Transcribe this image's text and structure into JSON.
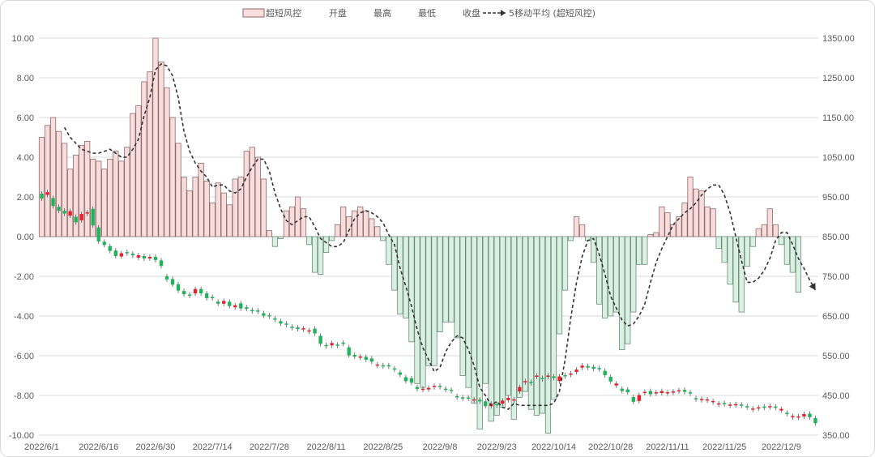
{
  "chart_data": {
    "type": "bar+candlestick+line",
    "legend": {
      "placement": "top-center",
      "items": [
        {
          "label": "超短风控",
          "kind": "bar"
        },
        {
          "label": "开盘",
          "kind": "none"
        },
        {
          "label": "最高",
          "kind": "none"
        },
        {
          "label": "最低",
          "kind": "none"
        },
        {
          "label": "收盘",
          "kind": "none"
        },
        {
          "label": "5移动平均 (超短风控)",
          "kind": "dashed-line"
        }
      ]
    },
    "colors": {
      "bar_pos_fill": "#f9dcdc",
      "bar_pos_stroke": "#8c6a6a",
      "bar_neg_fill": "#daf0e3",
      "bar_neg_stroke": "#6b8c78",
      "candle_up": "#e8202a",
      "candle_down": "#1fb35a",
      "ma_line": "#333333",
      "grid": "#d9d9d9"
    },
    "y_left": {
      "min": -10,
      "max": 10,
      "step": 2,
      "tick_labels": [
        "10.00",
        "8.00",
        "6.00",
        "4.00",
        "2.00",
        "0.00",
        "-2.00",
        "-4.00",
        "-6.00",
        "-8.00",
        "-10.00"
      ]
    },
    "y_right": {
      "min": 350,
      "max": 1350,
      "step": 100,
      "tick_labels": [
        "1350.00",
        "1250.00",
        "1150.00",
        "1050.00",
        "950.00",
        "850.00",
        "750.00",
        "650.00",
        "550.00",
        "450.00",
        "350.00"
      ]
    },
    "x_tick_labels": [
      "2022/6/1",
      "2022/6/16",
      "2022/6/30",
      "2022/7/14",
      "2022/7/28",
      "2022/8/11",
      "2022/8/25",
      "2022/9/8",
      "2022/9/23",
      "2022/10/14",
      "2022/10/28",
      "2022/11/11",
      "2022/11/25",
      "2022/12/9"
    ],
    "x_tick_indices": [
      0,
      10,
      20,
      30,
      40,
      50,
      60,
      70,
      80,
      90,
      100,
      110,
      120,
      130
    ],
    "n_slots": 137,
    "bars": [
      5.0,
      5.6,
      6.0,
      5.3,
      4.7,
      3.4,
      4.1,
      4.6,
      4.8,
      3.9,
      3.8,
      3.4,
      3.9,
      4.3,
      3.8,
      4.5,
      6.2,
      6.6,
      7.8,
      8.3,
      10.0,
      8.8,
      7.5,
      6.0,
      4.7,
      3.0,
      2.3,
      3.0,
      3.7,
      2.8,
      1.7,
      2.7,
      2.2,
      1.6,
      2.9,
      3.0,
      4.3,
      4.5,
      4.0,
      2.9,
      0.3,
      -0.5,
      -0.1,
      1.3,
      1.5,
      2.0,
      1.4,
      -0.4,
      -1.8,
      -1.9,
      -0.8,
      -0.2,
      0.6,
      1.5,
      1.0,
      1.3,
      1.5,
      1.3,
      0.9,
      0.5,
      -0.2,
      -1.4,
      -2.7,
      -3.9,
      -4.1,
      -5.3,
      -7.4,
      -7.6,
      -6.5,
      -6.5,
      -4.8,
      -4.3,
      -4.3,
      -5.1,
      -7.0,
      -7.6,
      -8.4,
      -9.7,
      -7.4,
      -9.3,
      -9.0,
      -8.6,
      -8.0,
      -9.2,
      -8.1,
      -7.8,
      -8.7,
      -9.0,
      -8.9,
      -9.9,
      -8.2,
      -4.9,
      -2.7,
      -0.2,
      1.0,
      0.6,
      -0.2,
      -1.3,
      -3.4,
      -4.1,
      -4.0,
      -3.8,
      -5.7,
      -5.4,
      -3.8,
      -1.4,
      -1.4,
      0.1,
      0.2,
      1.5,
      1.2,
      0.6,
      1.0,
      1.7,
      3.0,
      2.4,
      2.3,
      1.5,
      1.4,
      -0.6,
      -1.3,
      -2.4,
      -3.3,
      -3.8,
      -1.5,
      -0.5,
      0.4,
      0.6,
      1.4,
      0.6,
      -0.4,
      -1.4,
      -1.8,
      -2.8,
      0.0,
      0.0,
      0.0
    ],
    "ma5": [
      null,
      null,
      null,
      null,
      5.5,
      5.0,
      4.7,
      4.4,
      4.3,
      4.2,
      4.2,
      4.3,
      4.4,
      4.2,
      4.0,
      4.0,
      4.4,
      4.9,
      6.1,
      7.0,
      8.4,
      8.7,
      8.6,
      8.1,
      7.0,
      5.3,
      4.3,
      3.7,
      3.3,
      3.0,
      2.5,
      2.6,
      2.6,
      2.3,
      2.2,
      2.4,
      3.0,
      3.5,
      3.9,
      3.9,
      3.3,
      2.2,
      1.4,
      0.8,
      0.6,
      0.8,
      1.0,
      1.0,
      0.5,
      -0.1,
      -0.3,
      -0.5,
      -0.5,
      -0.3,
      0.3,
      0.9,
      1.2,
      1.3,
      1.2,
      1.0,
      0.7,
      0.1,
      -0.4,
      -1.6,
      -2.5,
      -3.5,
      -4.7,
      -5.6,
      -6.2,
      -6.8,
      -6.6,
      -5.8,
      -5.3,
      -5.0,
      -5.1,
      -5.7,
      -6.5,
      -7.6,
      -8.0,
      -8.5,
      -8.3,
      -8.6,
      -8.7,
      -8.4,
      -8.5,
      -8.5,
      -8.5,
      -8.5,
      -8.5,
      -8.5,
      -8.4,
      -7.8,
      -6.2,
      -4.1,
      -2.3,
      -1.0,
      -0.2,
      -0.1,
      -0.9,
      -1.9,
      -3.0,
      -3.6,
      -4.2,
      -4.5,
      -4.4,
      -4.0,
      -3.4,
      -2.3,
      -1.3,
      -0.6,
      0.0,
      0.6,
      0.9,
      1.2,
      1.4,
      1.7,
      2.1,
      2.4,
      2.6,
      2.6,
      2.1,
      1.2,
      0.0,
      -1.2,
      -2.3,
      -2.3,
      -2.1,
      -1.7,
      -1.1,
      -0.2,
      0.2,
      0.2,
      -0.4,
      -1.1,
      -1.6,
      -2.2,
      -2.7
    ],
    "candles": [
      [
        958,
        946
      ],
      [
        955,
        962
      ],
      [
        947,
        927
      ],
      [
        925,
        915
      ],
      [
        915,
        908
      ],
      [
        903,
        914
      ],
      [
        900,
        886
      ],
      [
        891,
        907
      ],
      [
        908,
        911
      ],
      [
        920,
        878
      ],
      [
        873,
        838
      ],
      [
        837,
        829
      ],
      [
        826,
        814
      ],
      [
        815,
        801
      ],
      [
        800,
        808
      ],
      [
        811,
        808
      ],
      [
        807,
        803
      ],
      [
        797,
        803
      ],
      [
        801,
        795
      ],
      [
        795,
        799
      ],
      [
        799,
        791
      ],
      [
        790,
        776
      ],
      [
        750,
        742
      ],
      [
        743,
        729
      ],
      [
        730,
        714
      ],
      [
        713,
        705
      ],
      [
        704,
        702
      ],
      [
        707,
        718
      ],
      [
        718,
        707
      ],
      [
        707,
        695
      ],
      [
        698,
        696
      ],
      [
        686,
        681
      ],
      [
        681,
        688
      ],
      [
        686,
        675
      ],
      [
        672,
        677
      ],
      [
        682,
        669
      ],
      [
        672,
        668
      ],
      [
        665,
        663
      ],
      [
        664,
        663
      ],
      [
        657,
        651
      ],
      [
        652,
        650
      ],
      [
        644,
        643
      ],
      [
        637,
        631
      ],
      [
        631,
        629
      ],
      [
        623,
        621
      ],
      [
        621,
        617
      ],
      [
        616,
        619
      ],
      [
        611,
        614
      ],
      [
        618,
        606
      ],
      [
        600,
        580
      ],
      [
        577,
        576
      ],
      [
        576,
        582
      ],
      [
        578,
        576
      ],
      [
        583,
        580
      ],
      [
        571,
        551
      ],
      [
        552,
        548
      ],
      [
        548,
        548
      ],
      [
        547,
        540
      ],
      [
        543,
        535
      ],
      [
        528,
        528
      ],
      [
        526,
        523
      ],
      [
        526,
        523
      ],
      [
        518,
        516
      ],
      [
        508,
        502
      ],
      [
        496,
        486
      ],
      [
        493,
        482
      ],
      [
        471,
        466
      ],
      [
        466,
        467
      ],
      [
        465,
        469
      ],
      [
        471,
        474
      ],
      [
        474,
        472
      ],
      [
        467,
        465
      ],
      [
        464,
        461
      ],
      [
        448,
        446
      ],
      [
        445,
        444
      ],
      [
        445,
        443
      ],
      [
        440,
        440
      ],
      [
        439,
        435
      ],
      [
        435,
        423
      ],
      [
        423,
        429
      ],
      [
        428,
        426
      ],
      [
        429,
        437
      ],
      [
        438,
        444
      ],
      [
        440,
        440
      ],
      [
        460,
        471
      ],
      [
        483,
        486
      ],
      [
        484,
        482
      ],
      [
        497,
        500
      ],
      [
        494,
        492
      ],
      [
        497,
        500
      ],
      [
        498,
        494
      ],
      [
        486,
        498
      ],
      [
        501,
        499
      ],
      [
        504,
        505
      ],
      [
        509,
        515
      ],
      [
        520,
        525
      ],
      [
        524,
        520
      ],
      [
        522,
        517
      ],
      [
        519,
        518
      ],
      [
        512,
        501
      ],
      [
        497,
        485
      ],
      [
        475,
        480
      ],
      [
        467,
        461
      ],
      [
        465,
        458
      ],
      [
        446,
        434
      ],
      [
        436,
        451
      ],
      [
        457,
        459
      ],
      [
        461,
        453
      ],
      [
        458,
        458
      ],
      [
        456,
        461
      ],
      [
        458,
        458
      ],
      [
        458,
        460
      ],
      [
        460,
        463
      ],
      [
        464,
        459
      ],
      [
        458,
        455
      ],
      [
        443,
        441
      ],
      [
        440,
        441
      ],
      [
        437,
        440
      ],
      [
        434,
        436
      ],
      [
        430,
        430
      ],
      [
        431,
        429
      ],
      [
        427,
        427
      ],
      [
        425,
        428
      ],
      [
        427,
        424
      ],
      [
        423,
        421
      ],
      [
        417,
        417
      ],
      [
        417,
        420
      ],
      [
        422,
        419
      ],
      [
        421,
        423
      ],
      [
        422,
        421
      ],
      [
        412,
        416
      ],
      [
        406,
        403
      ],
      [
        397,
        398
      ],
      [
        395,
        397
      ],
      [
        397,
        403
      ],
      [
        404,
        395
      ],
      [
        393,
        380
      ]
    ]
  }
}
